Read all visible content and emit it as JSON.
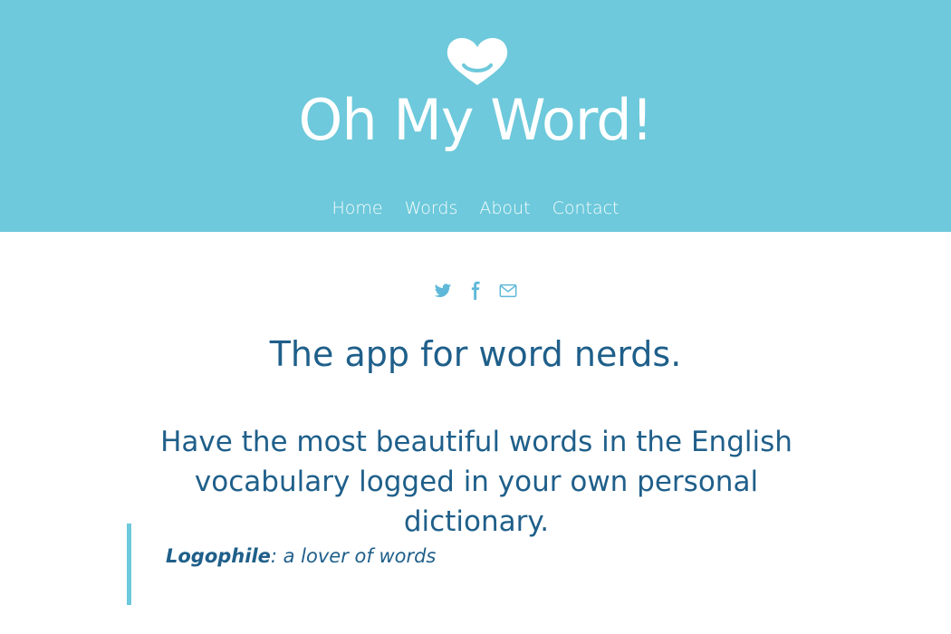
{
  "header": {
    "logo_text": "Oh My Word!",
    "logo_icon": "heart-icon",
    "background_color": "#6dc9db"
  },
  "nav": {
    "items": [
      {
        "label": "Home"
      },
      {
        "label": "Words"
      },
      {
        "label": "About"
      },
      {
        "label": "Contact"
      }
    ]
  },
  "social": {
    "icons": [
      "twitter-icon",
      "facebook-icon",
      "email-icon"
    ],
    "icon_color": "#5fb8d8"
  },
  "main": {
    "tagline": "The app for word nerds.",
    "intro": "Have the most beautiful words in the English vocabulary logged in your own personal dictionary.",
    "text_color": "#1f5f8a"
  },
  "quote": {
    "term": "Logophile",
    "definition": ": a lover of words",
    "border_color": "#6dc9db"
  }
}
